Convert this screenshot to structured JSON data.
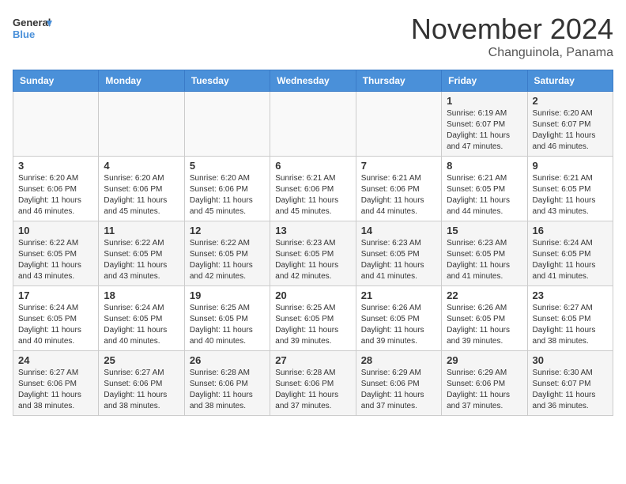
{
  "header": {
    "logo_line1": "General",
    "logo_line2": "Blue",
    "month": "November 2024",
    "location": "Changuinola, Panama"
  },
  "weekdays": [
    "Sunday",
    "Monday",
    "Tuesday",
    "Wednesday",
    "Thursday",
    "Friday",
    "Saturday"
  ],
  "weeks": [
    [
      {
        "day": "",
        "info": ""
      },
      {
        "day": "",
        "info": ""
      },
      {
        "day": "",
        "info": ""
      },
      {
        "day": "",
        "info": ""
      },
      {
        "day": "",
        "info": ""
      },
      {
        "day": "1",
        "info": "Sunrise: 6:19 AM\nSunset: 6:07 PM\nDaylight: 11 hours and 47 minutes."
      },
      {
        "day": "2",
        "info": "Sunrise: 6:20 AM\nSunset: 6:07 PM\nDaylight: 11 hours and 46 minutes."
      }
    ],
    [
      {
        "day": "3",
        "info": "Sunrise: 6:20 AM\nSunset: 6:06 PM\nDaylight: 11 hours and 46 minutes."
      },
      {
        "day": "4",
        "info": "Sunrise: 6:20 AM\nSunset: 6:06 PM\nDaylight: 11 hours and 45 minutes."
      },
      {
        "day": "5",
        "info": "Sunrise: 6:20 AM\nSunset: 6:06 PM\nDaylight: 11 hours and 45 minutes."
      },
      {
        "day": "6",
        "info": "Sunrise: 6:21 AM\nSunset: 6:06 PM\nDaylight: 11 hours and 45 minutes."
      },
      {
        "day": "7",
        "info": "Sunrise: 6:21 AM\nSunset: 6:06 PM\nDaylight: 11 hours and 44 minutes."
      },
      {
        "day": "8",
        "info": "Sunrise: 6:21 AM\nSunset: 6:05 PM\nDaylight: 11 hours and 44 minutes."
      },
      {
        "day": "9",
        "info": "Sunrise: 6:21 AM\nSunset: 6:05 PM\nDaylight: 11 hours and 43 minutes."
      }
    ],
    [
      {
        "day": "10",
        "info": "Sunrise: 6:22 AM\nSunset: 6:05 PM\nDaylight: 11 hours and 43 minutes."
      },
      {
        "day": "11",
        "info": "Sunrise: 6:22 AM\nSunset: 6:05 PM\nDaylight: 11 hours and 43 minutes."
      },
      {
        "day": "12",
        "info": "Sunrise: 6:22 AM\nSunset: 6:05 PM\nDaylight: 11 hours and 42 minutes."
      },
      {
        "day": "13",
        "info": "Sunrise: 6:23 AM\nSunset: 6:05 PM\nDaylight: 11 hours and 42 minutes."
      },
      {
        "day": "14",
        "info": "Sunrise: 6:23 AM\nSunset: 6:05 PM\nDaylight: 11 hours and 41 minutes."
      },
      {
        "day": "15",
        "info": "Sunrise: 6:23 AM\nSunset: 6:05 PM\nDaylight: 11 hours and 41 minutes."
      },
      {
        "day": "16",
        "info": "Sunrise: 6:24 AM\nSunset: 6:05 PM\nDaylight: 11 hours and 41 minutes."
      }
    ],
    [
      {
        "day": "17",
        "info": "Sunrise: 6:24 AM\nSunset: 6:05 PM\nDaylight: 11 hours and 40 minutes."
      },
      {
        "day": "18",
        "info": "Sunrise: 6:24 AM\nSunset: 6:05 PM\nDaylight: 11 hours and 40 minutes."
      },
      {
        "day": "19",
        "info": "Sunrise: 6:25 AM\nSunset: 6:05 PM\nDaylight: 11 hours and 40 minutes."
      },
      {
        "day": "20",
        "info": "Sunrise: 6:25 AM\nSunset: 6:05 PM\nDaylight: 11 hours and 39 minutes."
      },
      {
        "day": "21",
        "info": "Sunrise: 6:26 AM\nSunset: 6:05 PM\nDaylight: 11 hours and 39 minutes."
      },
      {
        "day": "22",
        "info": "Sunrise: 6:26 AM\nSunset: 6:05 PM\nDaylight: 11 hours and 39 minutes."
      },
      {
        "day": "23",
        "info": "Sunrise: 6:27 AM\nSunset: 6:05 PM\nDaylight: 11 hours and 38 minutes."
      }
    ],
    [
      {
        "day": "24",
        "info": "Sunrise: 6:27 AM\nSunset: 6:06 PM\nDaylight: 11 hours and 38 minutes."
      },
      {
        "day": "25",
        "info": "Sunrise: 6:27 AM\nSunset: 6:06 PM\nDaylight: 11 hours and 38 minutes."
      },
      {
        "day": "26",
        "info": "Sunrise: 6:28 AM\nSunset: 6:06 PM\nDaylight: 11 hours and 38 minutes."
      },
      {
        "day": "27",
        "info": "Sunrise: 6:28 AM\nSunset: 6:06 PM\nDaylight: 11 hours and 37 minutes."
      },
      {
        "day": "28",
        "info": "Sunrise: 6:29 AM\nSunset: 6:06 PM\nDaylight: 11 hours and 37 minutes."
      },
      {
        "day": "29",
        "info": "Sunrise: 6:29 AM\nSunset: 6:06 PM\nDaylight: 11 hours and 37 minutes."
      },
      {
        "day": "30",
        "info": "Sunrise: 6:30 AM\nSunset: 6:07 PM\nDaylight: 11 hours and 36 minutes."
      }
    ]
  ]
}
